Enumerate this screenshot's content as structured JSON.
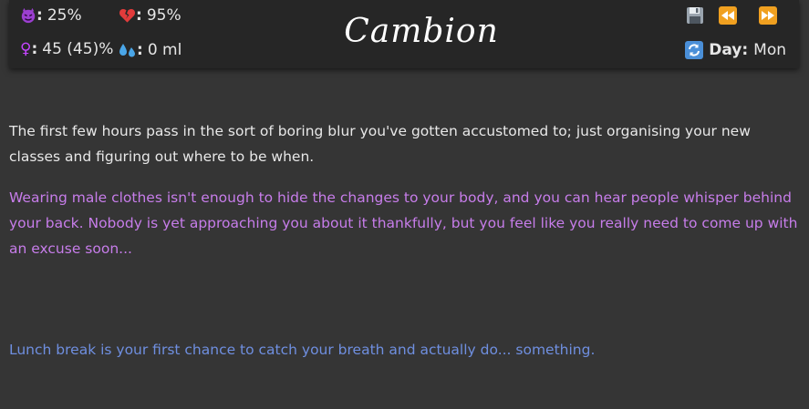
{
  "stats": {
    "corruption": {
      "icon": "demon-face-icon",
      "value": "25%"
    },
    "health": {
      "icon": "broken-heart-icon",
      "value": "95%"
    },
    "femininity": {
      "icon": "female-sign-icon",
      "value": "45 (45)%"
    },
    "fluids": {
      "icon": "sweat-droplets-icon",
      "value": "0 ml"
    }
  },
  "title": "Cambion",
  "toolbar": {
    "save_icon": "floppy-disk-icon",
    "rewind_icon": "rewind-icon",
    "forward_icon": "fast-forward-icon"
  },
  "day": {
    "icon": "refresh-arrows-icon",
    "label": "Day:",
    "value": "Mon"
  },
  "story": {
    "paragraph1": "The first few hours pass in the sort of boring blur you've gotten accustomed to; just organising your new classes and figuring out where to be when.",
    "paragraph2": "Wearing male clothes isn't enough to hide the changes to your body, and you can hear people whisper behind your back. Nobody is yet approaching you about it thankfully, but you feel like you really need to come up with an excuse soon...",
    "paragraph3": "Lunch break is your first chance to catch your breath and actually do... something."
  },
  "colors": {
    "background": "#353535",
    "topbar": "#262626",
    "narration": "#e8e8e8",
    "inner_thought": "#c77dea",
    "scene_text": "#6f8fe0",
    "button_orange": "#f0a020"
  }
}
